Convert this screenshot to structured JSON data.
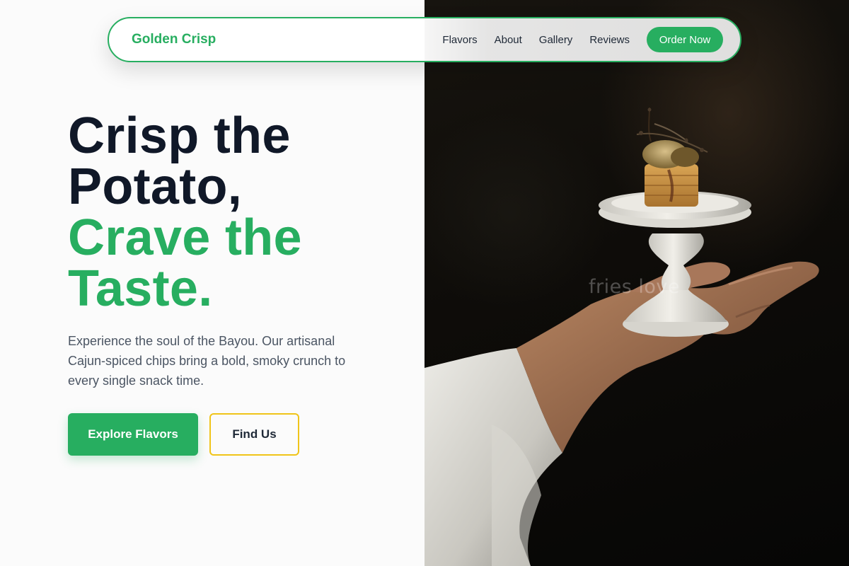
{
  "nav": {
    "brand": "Golden Crisp",
    "links": [
      "Flavors",
      "About",
      "Gallery",
      "Reviews"
    ],
    "cta": "Order Now"
  },
  "hero": {
    "title_lines": [
      "Crisp the",
      "Potato,"
    ],
    "accent_lines": [
      "Crave the",
      "Taste."
    ],
    "description": "Experience the soul of the Bayou. Our artisanal Cajun-spiced chips bring a bold, smoky crunch to every single snack time.",
    "primary_button": "Explore Flavors",
    "secondary_button": "Find Us"
  },
  "photo": {
    "alt": "Chef's hand holding a pedestal plate with a gourmet bite",
    "watermark": "fries love"
  },
  "colors": {
    "accent": "#27ae60",
    "heading": "#101828",
    "body_text": "#4b5563",
    "secondary_border": "#f0c419"
  }
}
